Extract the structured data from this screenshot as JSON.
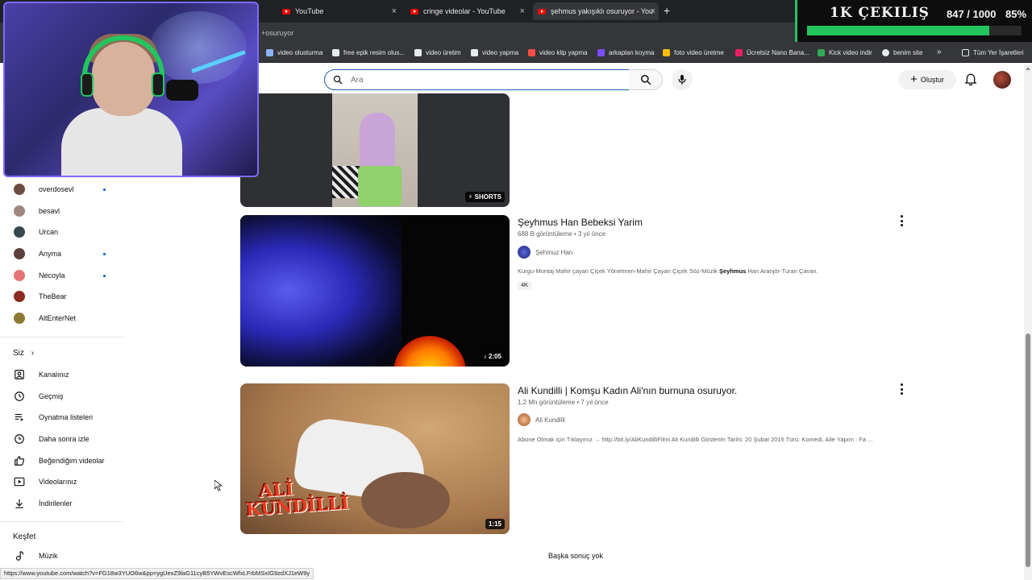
{
  "browser": {
    "tabs": [
      {
        "label": "YouTube",
        "active": false
      },
      {
        "label": "cringe videolar - YouTube",
        "active": false
      },
      {
        "label": "şehmus yakışıklı osuruyor - You",
        "active": true
      }
    ],
    "new_tab": "+",
    "close_glyph": "×",
    "address": "+osuruyor",
    "bookmarks": [
      {
        "label": "video olusturma",
        "color": "#8ab4f8"
      },
      {
        "label": "free epik resim olus...",
        "color": "#e8eaed"
      },
      {
        "label": "video üretim",
        "color": "#e8eaed"
      },
      {
        "label": "video yapma",
        "color": "#e8eaed"
      },
      {
        "label": "video klip yapma",
        "color": "#ff4e45"
      },
      {
        "label": "arkaplan koyma",
        "color": "#7c4dff"
      },
      {
        "label": "foto video üretme",
        "color": "#fbbc04"
      },
      {
        "label": "Ücretsiz Nano Bana...",
        "color": "#e91e63"
      },
      {
        "label": "Kick video indir",
        "color": "#34a853"
      },
      {
        "label": "benim site",
        "color": "#e8eaed"
      }
    ],
    "bookmarks_more": "»",
    "all_bookmarks": "Tüm Yer İşaretleri",
    "status_url": "https://www.youtube.com/watch?v=FG18w3YUO6w&pp=ygUexZ9laG11cyB5YWvEscWfxLFrbMSxIG9zdXJ1eW9y"
  },
  "giveaway": {
    "title": "1K ÇEKILIŞ",
    "count": "847 / 1000",
    "percent_label": "85%",
    "progress": 0.85,
    "accent": "#22c55e"
  },
  "header": {
    "search_placeholder": "Ara",
    "create_label": "Oluştur"
  },
  "sidebar": {
    "subscriptions": [
      {
        "label": "overdosevl",
        "live": true,
        "color": "#6d4c41"
      },
      {
        "label": "besavl",
        "live": false,
        "color": "#a1887f"
      },
      {
        "label": "Urcan",
        "live": false,
        "color": "#37474f"
      },
      {
        "label": "Anyma",
        "live": true,
        "color": "#5d4037"
      },
      {
        "label": "Necoyla",
        "live": true,
        "color": "#e57373"
      },
      {
        "label": "TheBear",
        "live": false,
        "color": "#8d2b1f"
      },
      {
        "label": "AltEnterNet",
        "live": false,
        "color": "#8d7a32"
      }
    ],
    "you_heading": "Siz",
    "you_items": [
      {
        "label": "Kanalınız",
        "icon": "channel-icon"
      },
      {
        "label": "Geçmiş",
        "icon": "history-icon"
      },
      {
        "label": "Oynatma listeleri",
        "icon": "playlists-icon"
      },
      {
        "label": "Daha sonra izle",
        "icon": "watch-later-icon"
      },
      {
        "label": "Beğendiğim videolar",
        "icon": "like-icon"
      },
      {
        "label": "Videolarınız",
        "icon": "your-videos-icon"
      },
      {
        "label": "İndirilenler",
        "icon": "download-icon"
      }
    ],
    "explore_heading": "Keşfet",
    "explore_items": [
      {
        "label": "Müzik",
        "icon": "music-icon"
      }
    ]
  },
  "results": [
    {
      "badge": "SHORTS"
    },
    {
      "title": "Şeyhmus Han Bebeksi Yarim",
      "meta": "688 B görüntüleme • 3 yıl önce",
      "channel": "Şehmuz Han",
      "desc_pre": "Kurgu-Montaj Mahir çayan Çiçek Yönetmen-Mahir Çayan Çiçek Söz-Müzik ",
      "desc_bold": "Şeyhmus",
      "desc_post": " Han Aranjör-Turan Çavan.",
      "chip": "4K",
      "duration": "2:05"
    },
    {
      "title": "Ali Kundilli | Komşu Kadın Ali'nın burnuna osuruyor.",
      "meta": "1,2 Mn görüntüleme • 7 yıl önce",
      "channel": "Ali Kundilli",
      "desc": "Abone Olmak için Tıklayınız → http://bit.ly/AliKundilliFilmi Ali Kundilli Gösterim Tarihi: 20 Şubat 2015 Türü: Komedi, Aile Yapım : Fa ...",
      "logo_text_1": "ALİ",
      "logo_text_2": "KUNDİLLİ",
      "duration": "1:15"
    }
  ],
  "no_more_results": "Başka sonuç yok"
}
